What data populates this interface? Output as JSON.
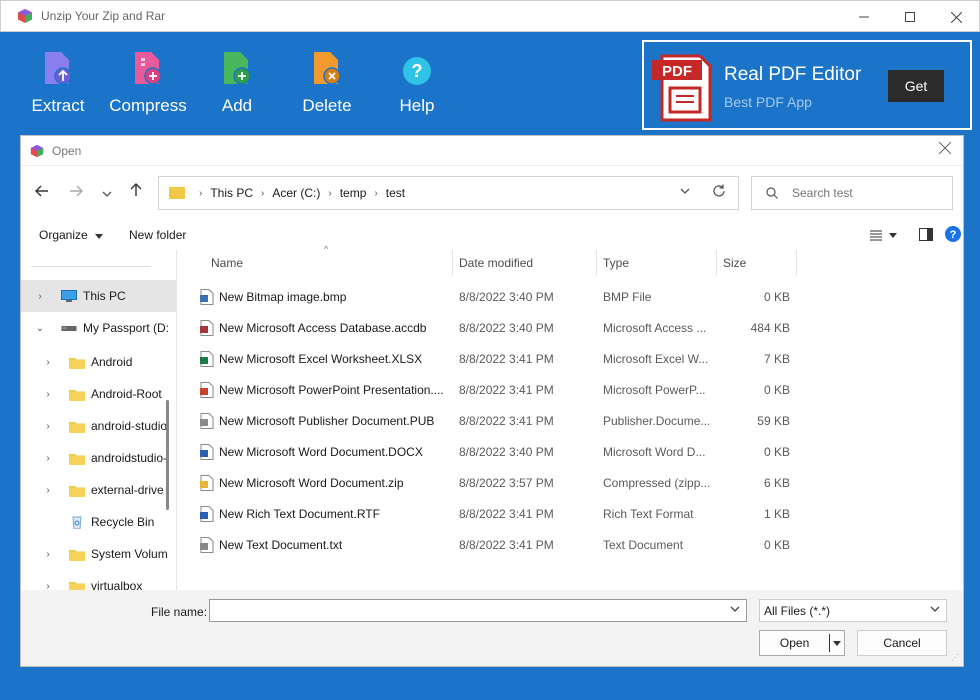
{
  "app": {
    "title": "Unzip Your Zip and Rar",
    "accent": "#1b74c8",
    "ribbon": [
      {
        "label": "Extract",
        "icon": "extract-icon",
        "color": "#8b7ff0"
      },
      {
        "label": "Compress",
        "icon": "compress-icon",
        "color": "#e95a9a"
      },
      {
        "label": "Add",
        "icon": "add-file-icon",
        "color": "#49b85c"
      },
      {
        "label": "Delete",
        "icon": "delete-file-icon",
        "color": "#f29a2e"
      },
      {
        "label": "Help",
        "icon": "help-icon",
        "color": "#2fc3e8"
      }
    ],
    "ad": {
      "icon_text": "PDF",
      "title": "Real PDF Editor",
      "subtitle": "Best PDF App",
      "button": "Get"
    }
  },
  "dialog": {
    "title": "Open",
    "breadcrumb": [
      "This PC",
      "Acer (C:)",
      "temp",
      "test"
    ],
    "search_placeholder": "Search test",
    "organize": "Organize",
    "new_folder": "New folder",
    "tree": [
      {
        "label": "This PC",
        "icon": "pc-icon",
        "arrow": "›",
        "selected": true
      },
      {
        "label": "My Passport (D:",
        "icon": "drive-icon",
        "arrow": "⌄"
      },
      {
        "label": "Android",
        "icon": "folder-icon",
        "arrow": "›"
      },
      {
        "label": "Android-Root",
        "icon": "folder-icon",
        "arrow": "›"
      },
      {
        "label": "android-studio",
        "icon": "folder-icon",
        "arrow": "›"
      },
      {
        "label": "androidstudio-",
        "icon": "folder-icon",
        "arrow": "›"
      },
      {
        "label": "external-drive",
        "icon": "folder-icon",
        "arrow": "›"
      },
      {
        "label": "Recycle Bin",
        "icon": "recycle-bin-icon",
        "arrow": ""
      },
      {
        "label": "System Volum",
        "icon": "folder-icon",
        "arrow": "›"
      },
      {
        "label": "virtualbox",
        "icon": "folder-icon",
        "arrow": "›"
      }
    ],
    "columns": [
      "Name",
      "Date modified",
      "Type",
      "Size"
    ],
    "files": [
      {
        "name": "New Bitmap image.bmp",
        "date": "8/8/2022 3:40 PM",
        "type": "BMP File",
        "size": "0 KB",
        "icon": "bitmap-file-icon",
        "icolor": "#3b6fb6"
      },
      {
        "name": "New Microsoft Access Database.accdb",
        "date": "8/8/2022 3:40 PM",
        "type": "Microsoft Access ...",
        "size": "484 KB",
        "icon": "access-file-icon",
        "icolor": "#a4373a"
      },
      {
        "name": "New Microsoft Excel Worksheet.XLSX",
        "date": "8/8/2022 3:41 PM",
        "type": "Microsoft Excel W...",
        "size": "7 KB",
        "icon": "excel-file-icon",
        "icolor": "#1d7a44"
      },
      {
        "name": "New Microsoft PowerPoint Presentation....",
        "date": "8/8/2022 3:41 PM",
        "type": "Microsoft PowerP...",
        "size": "0 KB",
        "icon": "powerpoint-file-icon",
        "icolor": "#c5442a"
      },
      {
        "name": "New Microsoft Publisher Document.PUB",
        "date": "8/8/2022 3:41 PM",
        "type": "Publisher.Docume...",
        "size": "59 KB",
        "icon": "publisher-file-icon",
        "icolor": "#888888"
      },
      {
        "name": "New Microsoft Word Document.DOCX",
        "date": "8/8/2022 3:40 PM",
        "type": "Microsoft Word D...",
        "size": "0 KB",
        "icon": "word-file-icon",
        "icolor": "#2b5fb3"
      },
      {
        "name": "New Microsoft Word Document.zip",
        "date": "8/8/2022 3:57 PM",
        "type": "Compressed (zipp...",
        "size": "6 KB",
        "icon": "zip-folder-icon",
        "icolor": "#e7b73a"
      },
      {
        "name": "New Rich Text Document.RTF",
        "date": "8/8/2022 3:41 PM",
        "type": "Rich Text Format",
        "size": "1 KB",
        "icon": "rtf-file-icon",
        "icolor": "#2b5fb3"
      },
      {
        "name": "New Text Document.txt",
        "date": "8/8/2022 3:41 PM",
        "type": "Text Document",
        "size": "0 KB",
        "icon": "text-file-icon",
        "icolor": "#888888"
      }
    ],
    "file_name_label": "File name:",
    "file_name_value": "",
    "filter": "All Files (*.*)",
    "open_button": "Open",
    "cancel_button": "Cancel"
  }
}
